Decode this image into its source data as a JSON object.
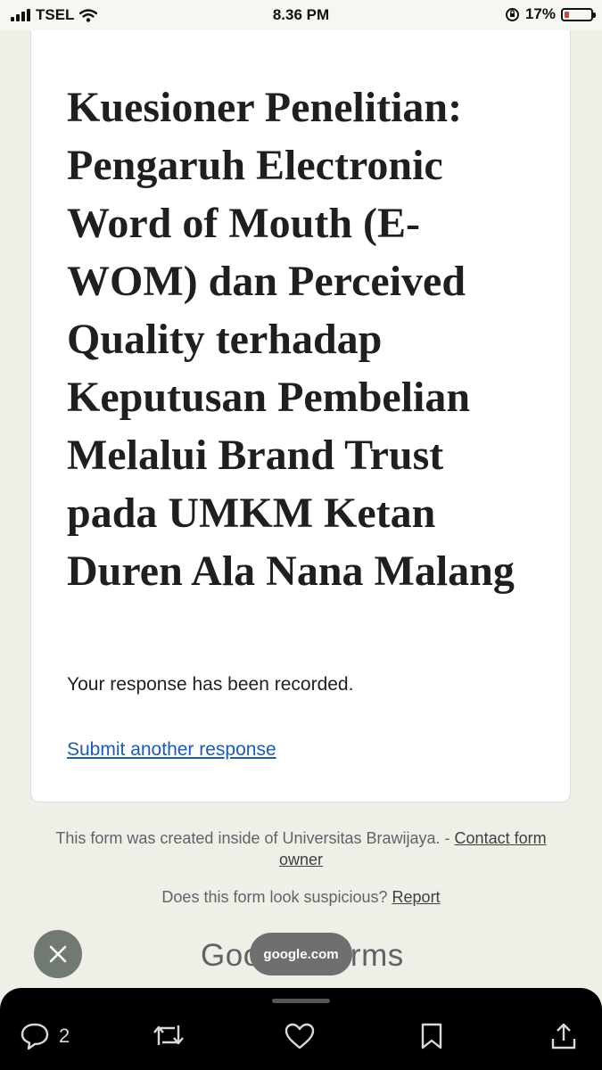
{
  "status_bar": {
    "carrier": "TSEL",
    "time": "8.36 PM",
    "battery_percent": "17%",
    "battery_level": 0.17
  },
  "form": {
    "title": "Kuesioner Penelitian: Pengaruh Electronic Word of Mouth (E-WOM) dan Perceived Quality terhadap Keputusan Pembelian Melalui Brand Trust pada UMKM Ketan Duren Ala Nana Malang",
    "confirmation": "Your response has been recorded.",
    "submit_another": "Submit another response"
  },
  "footer": {
    "created_text": "This form was created inside of Universitas Brawijaya. - ",
    "contact_link": "Contact form owner",
    "suspicious_text": "Does this form look suspicious? ",
    "report_link": "Report",
    "brand": "Google Forms"
  },
  "overlay": {
    "url": "google.com"
  },
  "bottom_actions": {
    "reply_count": "2"
  },
  "colors": {
    "link": "#1a5ab8",
    "battery_low": "#e53935"
  }
}
